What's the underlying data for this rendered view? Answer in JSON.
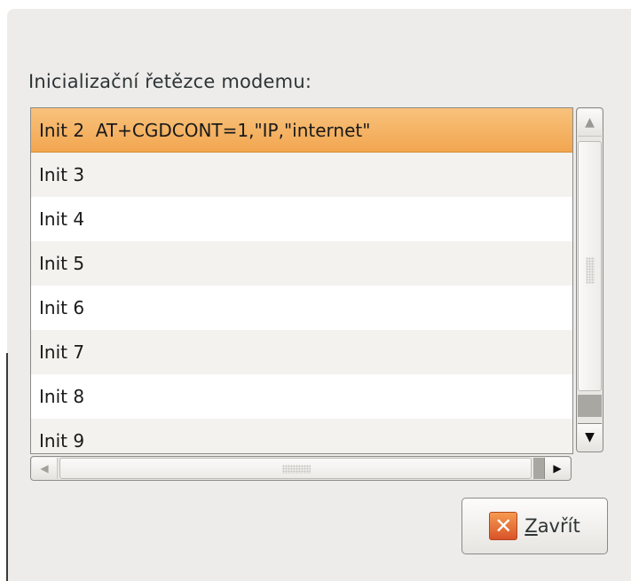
{
  "dialog": {
    "section_label": "Inicializační řetězce modemu:"
  },
  "init_list": {
    "rows": [
      {
        "label": "Init 2  AT+CGDCONT=1,\"IP,\"internet\"",
        "selected": true
      },
      {
        "label": "Init 3",
        "selected": false
      },
      {
        "label": "Init 4",
        "selected": false
      },
      {
        "label": "Init 5",
        "selected": false
      },
      {
        "label": "Init 6",
        "selected": false
      },
      {
        "label": "Init 7",
        "selected": false
      },
      {
        "label": "Init 8",
        "selected": false
      },
      {
        "label": "Init 9",
        "selected": false
      }
    ]
  },
  "scrollbars": {
    "vertical": {
      "up_icon": "arrow-up-icon",
      "down_icon": "arrow-down-icon"
    },
    "horizontal": {
      "left_icon": "arrow-left-icon",
      "right_icon": "arrow-right-icon"
    }
  },
  "buttons": {
    "close": {
      "mnemonic": "Z",
      "rest": "avřít",
      "icon": "close-icon"
    }
  },
  "colors": {
    "selection": "#f2a650",
    "window_bg": "#edeceb",
    "close_icon": "#e06a34"
  }
}
